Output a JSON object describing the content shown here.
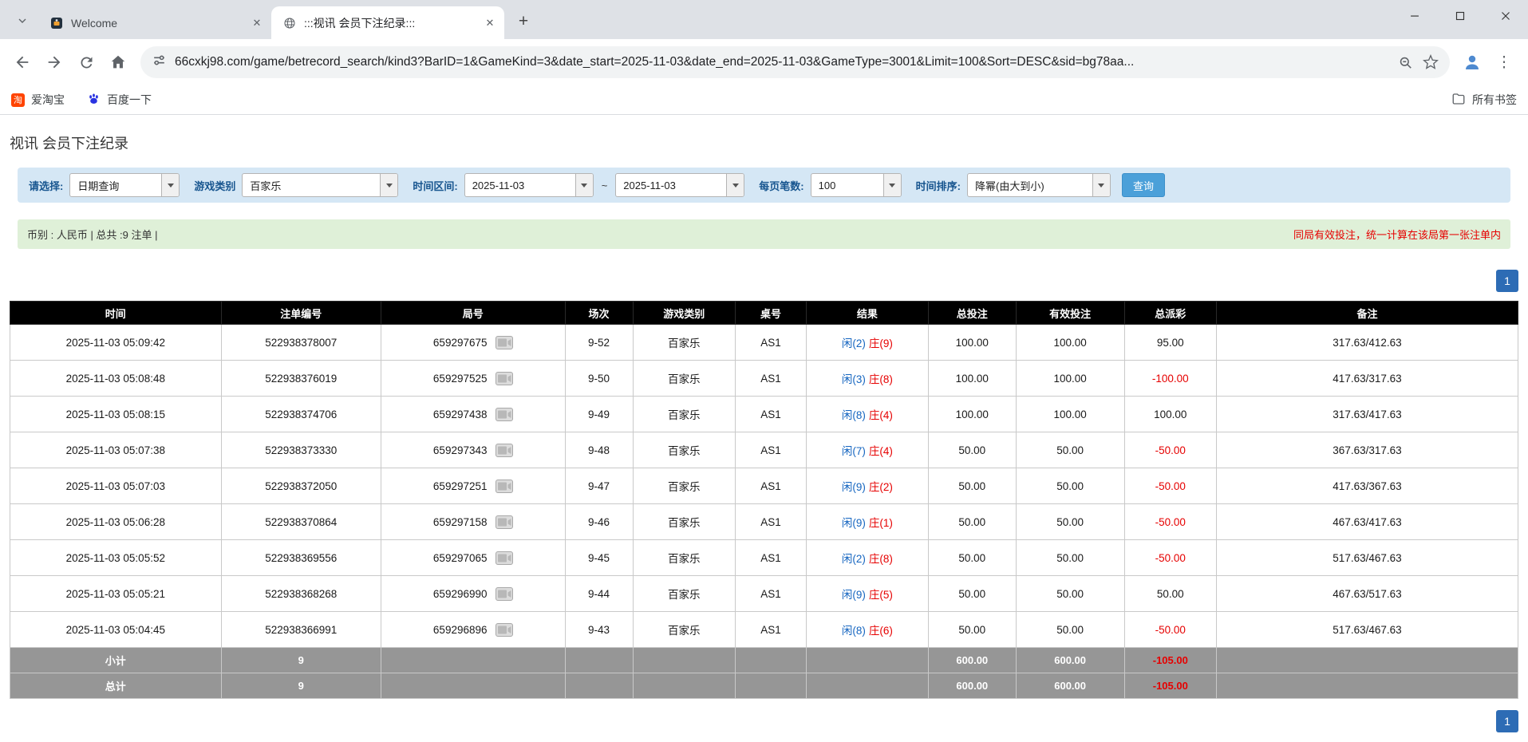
{
  "browser": {
    "tabs": [
      {
        "title": "Welcome"
      },
      {
        "title": ":::视讯 会员下注纪录:::"
      }
    ],
    "url": "66cxkj98.com/game/betrecord_search/kind3?BarID=1&GameKind=3&date_start=2025-11-03&date_end=2025-11-03&GameType=3001&Limit=100&Sort=DESC&sid=bg78aa...",
    "bookmarks": [
      {
        "label": "爱淘宝"
      },
      {
        "label": "百度一下"
      }
    ],
    "all_bookmarks_label": "所有书签"
  },
  "icons": {
    "tab_close": "✕",
    "new_tab": "+",
    "menu_dots": "⋮",
    "taobao_glyph": "淘"
  },
  "page": {
    "title": "视讯 会员下注纪录",
    "filter": {
      "select_label": "请选择:",
      "select_value": "日期查询",
      "game_type_label": "游戏类别",
      "game_type_value": "百家乐",
      "date_range_label": "时间区间:",
      "date_start": "2025-11-03",
      "date_separator": "~",
      "date_end": "2025-11-03",
      "page_size_label": "每页笔数:",
      "page_size_value": "100",
      "sort_label": "时间排序:",
      "sort_value": "降幂(由大到小)",
      "search_button": "查询"
    },
    "info": {
      "summary": "币别 : 人民币 | 总共 :9 注单 |",
      "notice": "同局有效投注，统一计算在该局第一张注单内"
    },
    "pagination": {
      "page": "1"
    },
    "table": {
      "headers": [
        "时间",
        "注单编号",
        "局号",
        "场次",
        "游戏类别",
        "桌号",
        "结果",
        "总投注",
        "有效投注",
        "总派彩",
        "备注"
      ],
      "rows": [
        {
          "time": "2025-11-03 05:09:42",
          "bet_id": "522938378007",
          "round_id": "659297675",
          "session": "9-52",
          "game": "百家乐",
          "table_no": "AS1",
          "result_player": "闲(2)",
          "result_banker": "庄(9)",
          "total_bet": "100.00",
          "valid_bet": "100.00",
          "payout": "95.00",
          "note": "317.63/412.63"
        },
        {
          "time": "2025-11-03 05:08:48",
          "bet_id": "522938376019",
          "round_id": "659297525",
          "session": "9-50",
          "game": "百家乐",
          "table_no": "AS1",
          "result_player": "闲(3)",
          "result_banker": "庄(8)",
          "total_bet": "100.00",
          "valid_bet": "100.00",
          "payout": "-100.00",
          "note": "417.63/317.63"
        },
        {
          "time": "2025-11-03 05:08:15",
          "bet_id": "522938374706",
          "round_id": "659297438",
          "session": "9-49",
          "game": "百家乐",
          "table_no": "AS1",
          "result_player": "闲(8)",
          "result_banker": "庄(4)",
          "total_bet": "100.00",
          "valid_bet": "100.00",
          "payout": "100.00",
          "note": "317.63/417.63"
        },
        {
          "time": "2025-11-03 05:07:38",
          "bet_id": "522938373330",
          "round_id": "659297343",
          "session": "9-48",
          "game": "百家乐",
          "table_no": "AS1",
          "result_player": "闲(7)",
          "result_banker": "庄(4)",
          "total_bet": "50.00",
          "valid_bet": "50.00",
          "payout": "-50.00",
          "note": "367.63/317.63"
        },
        {
          "time": "2025-11-03 05:07:03",
          "bet_id": "522938372050",
          "round_id": "659297251",
          "session": "9-47",
          "game": "百家乐",
          "table_no": "AS1",
          "result_player": "闲(9)",
          "result_banker": "庄(2)",
          "total_bet": "50.00",
          "valid_bet": "50.00",
          "payout": "-50.00",
          "note": "417.63/367.63"
        },
        {
          "time": "2025-11-03 05:06:28",
          "bet_id": "522938370864",
          "round_id": "659297158",
          "session": "9-46",
          "game": "百家乐",
          "table_no": "AS1",
          "result_player": "闲(9)",
          "result_banker": "庄(1)",
          "total_bet": "50.00",
          "valid_bet": "50.00",
          "payout": "-50.00",
          "note": "467.63/417.63"
        },
        {
          "time": "2025-11-03 05:05:52",
          "bet_id": "522938369556",
          "round_id": "659297065",
          "session": "9-45",
          "game": "百家乐",
          "table_no": "AS1",
          "result_player": "闲(2)",
          "result_banker": "庄(8)",
          "total_bet": "50.00",
          "valid_bet": "50.00",
          "payout": "-50.00",
          "note": "517.63/467.63"
        },
        {
          "time": "2025-11-03 05:05:21",
          "bet_id": "522938368268",
          "round_id": "659296990",
          "session": "9-44",
          "game": "百家乐",
          "table_no": "AS1",
          "result_player": "闲(9)",
          "result_banker": "庄(5)",
          "total_bet": "50.00",
          "valid_bet": "50.00",
          "payout": "50.00",
          "note": "467.63/517.63"
        },
        {
          "time": "2025-11-03 05:04:45",
          "bet_id": "522938366991",
          "round_id": "659296896",
          "session": "9-43",
          "game": "百家乐",
          "table_no": "AS1",
          "result_player": "闲(8)",
          "result_banker": "庄(6)",
          "total_bet": "50.00",
          "valid_bet": "50.00",
          "payout": "-50.00",
          "note": "517.63/467.63"
        }
      ],
      "footer": [
        {
          "label": "小计",
          "count": "9",
          "total_bet": "600.00",
          "valid_bet": "600.00",
          "payout": "-105.00"
        },
        {
          "label": "总计",
          "count": "9",
          "total_bet": "600.00",
          "valid_bet": "600.00",
          "payout": "-105.00"
        }
      ]
    }
  },
  "colors": {
    "accent_blue": "#1565c0",
    "negative_red": "#e60000",
    "filter_bg": "#d5e7f5",
    "info_bg": "#dff0d8",
    "table_header_bg": "#000000",
    "table_footer_bg": "#969696",
    "pager_bg": "#2d6cb5",
    "search_button_bg": "#4ba0d9"
  }
}
